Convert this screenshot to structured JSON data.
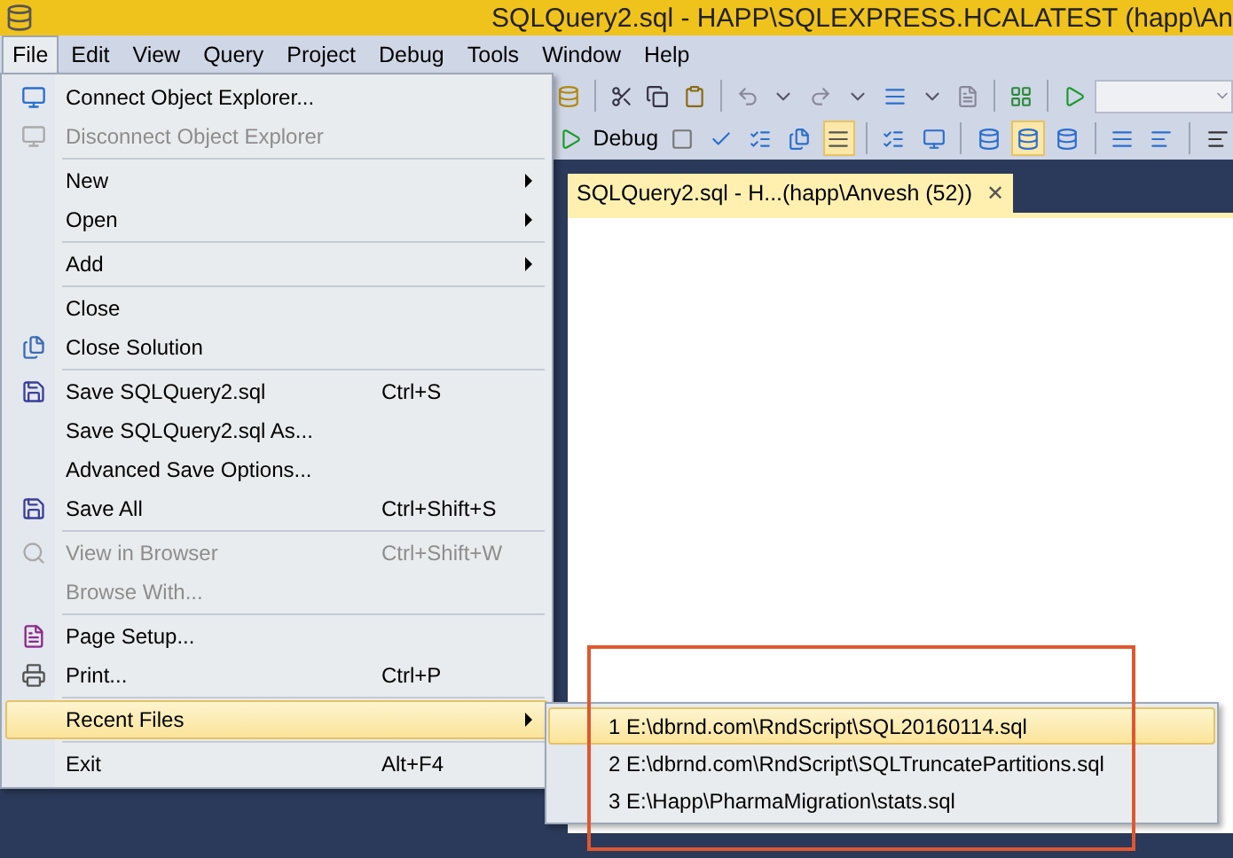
{
  "window": {
    "title": "SQLQuery2.sql - HAPP\\SQLEXPRESS.HCALATEST (happ\\An"
  },
  "menu_bar": [
    {
      "label": "File",
      "selected": true
    },
    {
      "label": "Edit",
      "selected": false
    },
    {
      "label": "View",
      "selected": false
    },
    {
      "label": "Query",
      "selected": false
    },
    {
      "label": "Project",
      "selected": false
    },
    {
      "label": "Debug",
      "selected": false
    },
    {
      "label": "Tools",
      "selected": false
    },
    {
      "label": "Window",
      "selected": false
    },
    {
      "label": "Help",
      "selected": false
    }
  ],
  "toolbar": {
    "debug_label": "Debug"
  },
  "document_tab": {
    "label": "SQLQuery2.sql - H...(happ\\Anvesh (52))",
    "close": "✕"
  },
  "file_menu": [
    {
      "kind": "item",
      "label": "Connect Object Explorer...",
      "disabled": false,
      "selected": false,
      "submenu": false
    },
    {
      "kind": "item",
      "label": "Disconnect Object Explorer",
      "disabled": true,
      "selected": false,
      "submenu": false
    },
    {
      "kind": "separator"
    },
    {
      "kind": "item",
      "label": "New",
      "disabled": false,
      "selected": false,
      "submenu": true
    },
    {
      "kind": "item",
      "label": "Open",
      "disabled": false,
      "selected": false,
      "submenu": true
    },
    {
      "kind": "separator"
    },
    {
      "kind": "item",
      "label": "Add",
      "disabled": false,
      "selected": false,
      "submenu": true
    },
    {
      "kind": "separator"
    },
    {
      "kind": "item",
      "label": "Close",
      "disabled": false,
      "selected": false,
      "submenu": false
    },
    {
      "kind": "item",
      "label": "Close Solution",
      "disabled": false,
      "selected": false,
      "submenu": false
    },
    {
      "kind": "separator"
    },
    {
      "kind": "item",
      "label": "Save SQLQuery2.sql",
      "shortcut": "Ctrl+S",
      "disabled": false,
      "selected": false,
      "submenu": false
    },
    {
      "kind": "item",
      "label": "Save SQLQuery2.sql As...",
      "disabled": false,
      "selected": false,
      "submenu": false
    },
    {
      "kind": "item",
      "label": "Advanced Save Options...",
      "disabled": false,
      "selected": false,
      "submenu": false
    },
    {
      "kind": "item",
      "label": "Save All",
      "shortcut": "Ctrl+Shift+S",
      "disabled": false,
      "selected": false,
      "submenu": false
    },
    {
      "kind": "separator"
    },
    {
      "kind": "item",
      "label": "View in Browser",
      "shortcut": "Ctrl+Shift+W",
      "disabled": true,
      "selected": false,
      "submenu": false
    },
    {
      "kind": "item",
      "label": "Browse With...",
      "disabled": true,
      "selected": false,
      "submenu": false
    },
    {
      "kind": "separator"
    },
    {
      "kind": "item",
      "label": "Page Setup...",
      "disabled": false,
      "selected": false,
      "submenu": false
    },
    {
      "kind": "item",
      "label": "Print...",
      "shortcut": "Ctrl+P",
      "disabled": false,
      "selected": false,
      "submenu": false
    },
    {
      "kind": "separator"
    },
    {
      "kind": "item",
      "label": "Recent Files",
      "disabled": false,
      "selected": true,
      "submenu": true
    },
    {
      "kind": "separator"
    },
    {
      "kind": "item",
      "label": "Exit",
      "shortcut": "Alt+F4",
      "disabled": false,
      "selected": false,
      "submenu": false
    }
  ],
  "recent_files": [
    {
      "label": "1 E:\\dbrnd.com\\RndScript\\SQL20160114.sql",
      "selected": true
    },
    {
      "label": "2 E:\\dbrnd.com\\RndScript\\SQLTruncatePartitions.sql",
      "selected": false
    },
    {
      "label": "3 E:\\Happ\\PharmaMigration\\stats.sql",
      "selected": false
    }
  ]
}
